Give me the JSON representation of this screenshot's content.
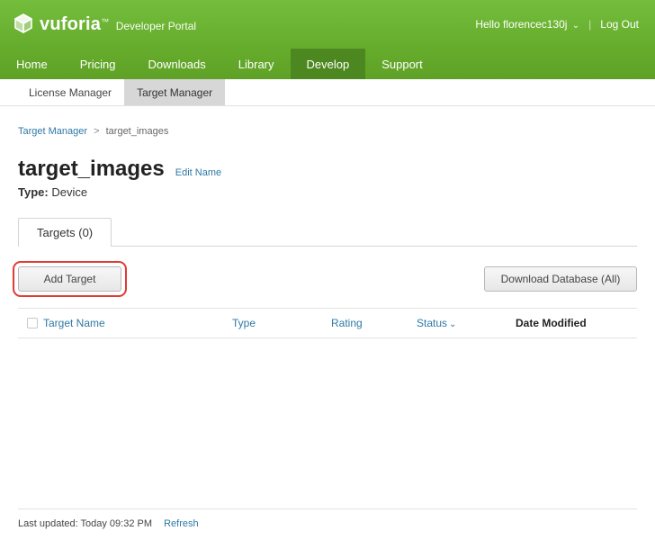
{
  "brand": {
    "name": "vuforia",
    "tm": "™",
    "subtitle": "Developer Portal"
  },
  "top": {
    "greeting_prefix": "Hello",
    "username": "florencec130j",
    "logout": "Log Out"
  },
  "nav": {
    "items": [
      {
        "label": "Home"
      },
      {
        "label": "Pricing"
      },
      {
        "label": "Downloads"
      },
      {
        "label": "Library"
      },
      {
        "label": "Develop",
        "active": true
      },
      {
        "label": "Support"
      }
    ]
  },
  "subnav": {
    "items": [
      {
        "label": "License Manager"
      },
      {
        "label": "Target Manager",
        "active": true
      }
    ]
  },
  "breadcrumb": {
    "root": "Target Manager",
    "sep": ">",
    "current": "target_images"
  },
  "page": {
    "title": "target_images",
    "edit_name": "Edit Name",
    "type_label": "Type:",
    "type_value": "Device"
  },
  "tabs": {
    "targets_label": "Targets (0)"
  },
  "buttons": {
    "add_target": "Add Target",
    "download_db": "Download Database (All)"
  },
  "columns": {
    "name": "Target Name",
    "type": "Type",
    "rating": "Rating",
    "status": "Status",
    "date": "Date Modified"
  },
  "footer": {
    "last_updated": "Last updated: Today 09:32 PM",
    "refresh": "Refresh"
  }
}
